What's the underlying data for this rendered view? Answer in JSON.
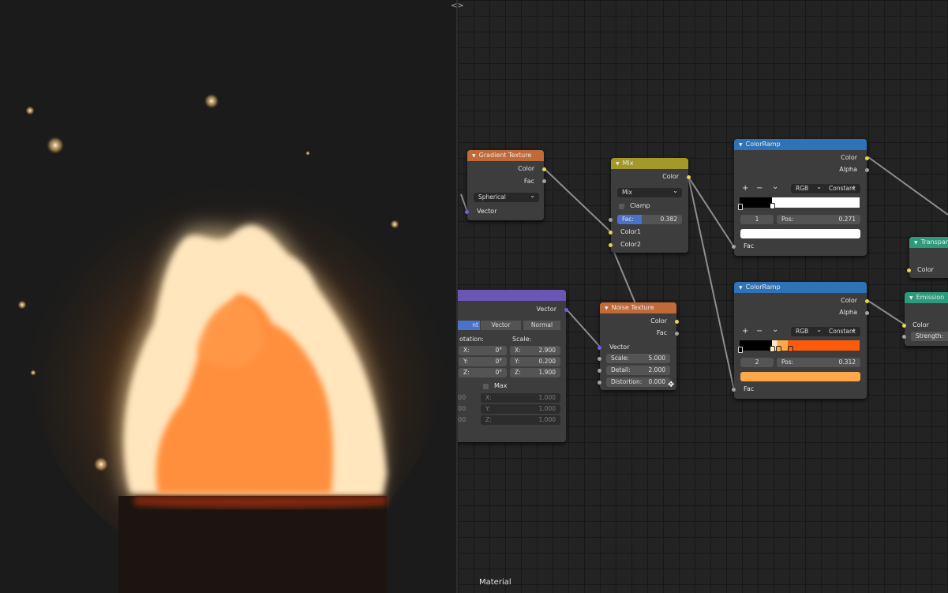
{
  "app": {
    "collapse_glyph": "<>",
    "editor_label": "Material"
  },
  "colors": {
    "texture_header": "#c06a3a",
    "converter_header": "#2e73b8",
    "mix_header": "#a3992a",
    "vector_header": "#6a57b5",
    "shader_header": "#2c9a7b",
    "fire_core": "#ff8c3a",
    "fire_glow": "#ffe3b0"
  },
  "nodes": {
    "gradient_texture": {
      "title": "Gradient Texture",
      "outputs": [
        "Color",
        "Fac"
      ],
      "type_value": "Spherical",
      "input": "Vector"
    },
    "mix": {
      "title": "Mix",
      "output": "Color",
      "blend_value": "Mix",
      "clamp_label": "Clamp",
      "fac_label": "Fac:",
      "fac_value": "0.382",
      "fac_fraction": 0.382,
      "inputs": [
        "Color1",
        "Color2"
      ]
    },
    "colorramp_top": {
      "title": "ColorRamp",
      "outputs": [
        "Color",
        "Alpha"
      ],
      "tools": [
        "+",
        "−",
        "⌄"
      ],
      "color_mode": "RGB",
      "interpolation": "Constant",
      "index": "1",
      "pos_label": "Pos:",
      "pos_value": "0.271",
      "stop_color": "#ffffff",
      "input": "Fac"
    },
    "colorramp_bottom": {
      "title": "ColorRamp",
      "outputs": [
        "Color",
        "Alpha"
      ],
      "tools": [
        "+",
        "−",
        "⌄"
      ],
      "color_mode": "RGB",
      "interpolation": "Constant",
      "index": "2",
      "pos_label": "Pos:",
      "pos_value": "0.312",
      "stop_color": "#ffa84a",
      "ramp_accent": "#ff5a0a",
      "input": "Fac"
    },
    "mapping": {
      "output": "Vector",
      "type_buttons": [
        "nt",
        "Vector",
        "Normal"
      ],
      "rotation_label": "otation:",
      "scale_label": "Scale:",
      "rotation": [
        {
          "axis": "X:",
          "value": "0°"
        },
        {
          "axis": "Y:",
          "value": "0°"
        },
        {
          "axis": "Z:",
          "value": "0°"
        }
      ],
      "scale": [
        {
          "axis": "X:",
          "value": "2.900"
        },
        {
          "axis": "Y:",
          "value": "0.200"
        },
        {
          "axis": "Z:",
          "value": "1.900"
        }
      ],
      "max_label": "Max",
      "min_dim": [
        {
          "left": "00",
          "axis": "X:",
          "value": "1.000"
        },
        {
          "left": "00",
          "axis": "Y:",
          "value": "1.000"
        },
        {
          "left": "00",
          "axis": "Z:",
          "value": "1.000"
        }
      ]
    },
    "noise_texture": {
      "title": "Noise Texture",
      "outputs": [
        "Color",
        "Fac"
      ],
      "input": "Vector",
      "fields": [
        {
          "label": "Scale:",
          "value": "5.000"
        },
        {
          "label": "Detail:",
          "value": "2.000"
        },
        {
          "label": "Distortion:",
          "value": "0.000"
        }
      ]
    },
    "transparent": {
      "title": "Transpare",
      "input": "Color"
    },
    "emission": {
      "title": "Emission",
      "input": "Color",
      "strength_label": "Strength:"
    }
  }
}
